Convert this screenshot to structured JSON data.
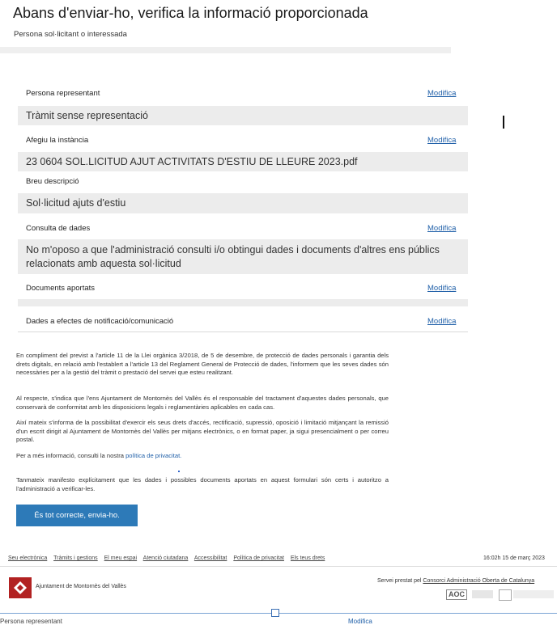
{
  "page": {
    "title": "Abans d'enviar-ho, verifica la informació proporcionada",
    "subtitle": "Persona sol·licitant o interessada"
  },
  "sections": [
    {
      "label": "Persona representant",
      "action": "Modifica",
      "value": "Tràmit sense representació"
    },
    {
      "label": "Afegiu la instància",
      "action": "Modifica",
      "value": "23 0604 SOL.LICITUD AJUT ACTIVITATS D'ESTIU DE LLEURE 2023.pdf"
    },
    {
      "label": "Breu descripció",
      "value": "Sol·licitud ajuts d'estiu"
    },
    {
      "label": "Consulta de dades",
      "action": "Modifica",
      "value": "No m'oposo a que l'administració consulti i/o obtingui dades i documents d'altres ens públics relacionats amb aquesta sol·licitud"
    },
    {
      "label": "Documents aportats",
      "action": "Modifica",
      "value": ""
    },
    {
      "label": "Dades a efectes de notificació/comunicació",
      "action": "Modifica"
    }
  ],
  "legal": {
    "p1": "En compliment del previst a l'article 11 de la Llei orgànica 3/2018, de 5 de desembre, de protecció de dades personals i garantia dels drets digitals, en relació amb l'establert a l'article 13 del Reglament General de Protecció de dades, l'informem que les seves dades són necessàries per a la gestió del tràmit o prestació del servei que esteu realitzant.",
    "p2": "Al respecte, s'indica que l'ens Ajuntament de Montornès del Vallès és el responsable del tractament d'aquestes dades personals, que conservarà de conformitat amb les disposicions legals i reglamentàries aplicables en cada cas.",
    "p3": "Així mateix s'informa de la possibilitat d'exercir els seus drets d'accés, rectificació, supressió, oposició i limitació mitjançant la remissió d'un escrit dirigit al Ajuntament de Montornès del Vallès per mitjans electrònics, o en format paper, ja sigui presencialment o per correu postal.",
    "p4_prefix": "Per a més informació, consulti la nostra ",
    "p4_link": "política de privacitat.",
    "p5": "Tanmateix manifesto explícitament que les dades i possibles documents aportats en aquest formulari són certs i autoritzo a l'administració a verificar-les."
  },
  "submit_label": "És tot correcte, envia-ho.",
  "footer": {
    "links": [
      "Seu electrònica",
      "Tràmits i gestions",
      "El meu espai",
      "Atenció ciutadana",
      "Accessibilitat",
      "Política de privacitat",
      "Els teus drets"
    ],
    "time": "16:02h 15 de març 2023",
    "org_name": "Ajuntament de Montornès del Vallès",
    "servei_prefix": "Servei prestat pel ",
    "servei_link": "Consorci Administració Oberta de Catalunya",
    "aoc_label": "AOC"
  },
  "bottom_cut": {
    "left": "Persona representant",
    "right": "Modifica"
  },
  "colors": {
    "accent": "#2d7ab8",
    "link": "#1f5fa8",
    "box_bg": "#ececec",
    "logo": "#b22222"
  }
}
